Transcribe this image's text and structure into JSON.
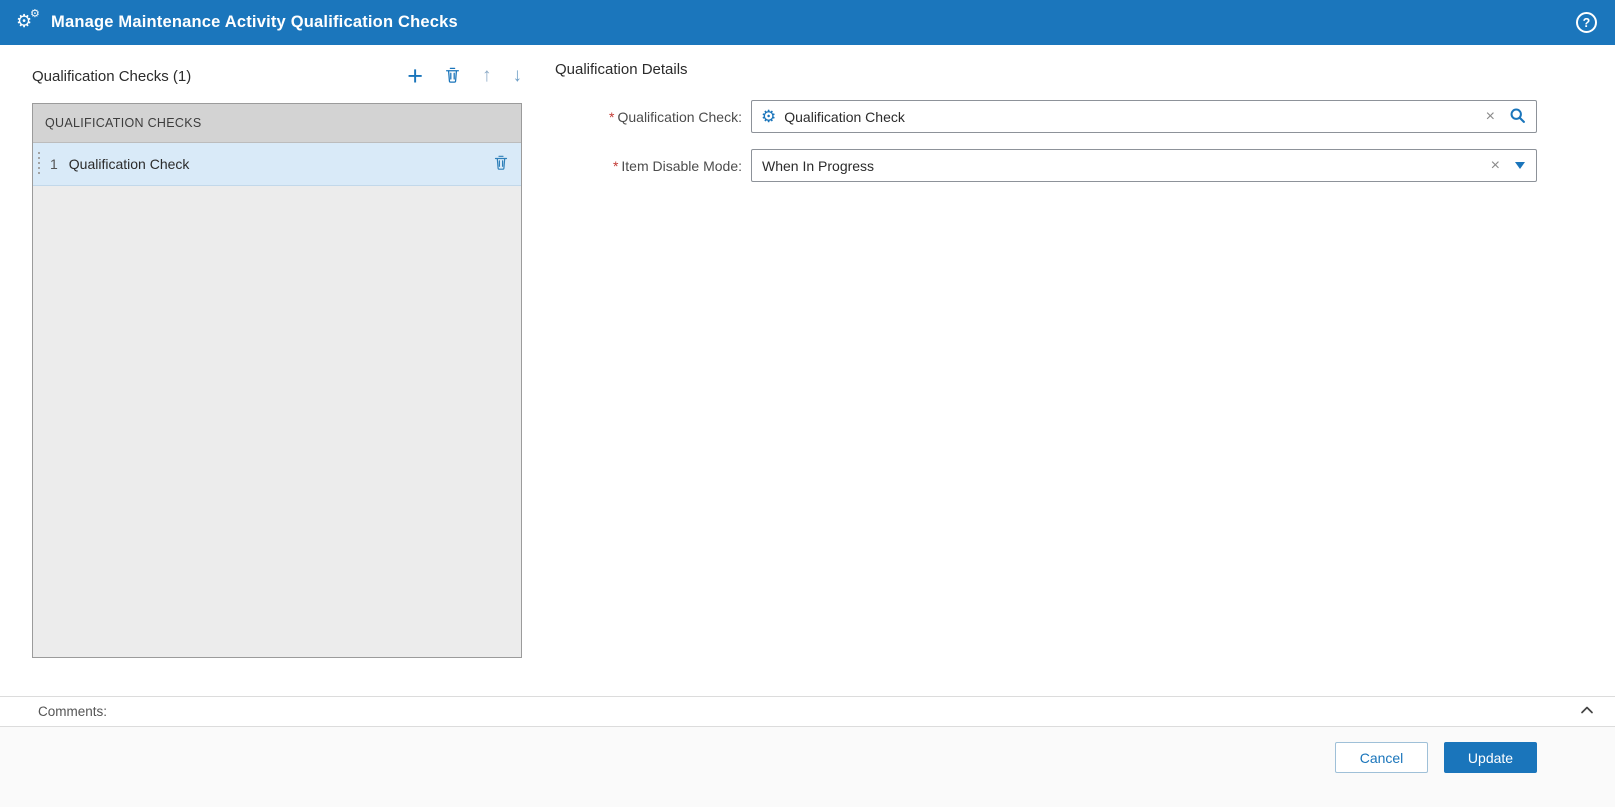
{
  "colors": {
    "accent": "#1b76bc",
    "icon_blue": "#1a75bb",
    "required": "#c23934",
    "selected_row": "#d9eaf8"
  },
  "header": {
    "title": "Manage Maintenance Activity Qualification Checks",
    "help_glyph": "?"
  },
  "left_panel": {
    "title": "Qualification Checks (1)",
    "toolbar": {
      "add_glyph": "+",
      "move_up_glyph": "↑",
      "move_down_glyph": "↓"
    },
    "list": {
      "header": "QUALIFICATION CHECKS",
      "rows": [
        {
          "index": "1",
          "label": "Qualification Check"
        }
      ]
    }
  },
  "details": {
    "title": "Qualification Details",
    "fields": {
      "qualification_check": {
        "required_glyph": "*",
        "label": "Qualification Check:",
        "value": "Qualification Check",
        "clear_glyph": "×"
      },
      "item_disable_mode": {
        "required_glyph": "*",
        "label": "Item Disable Mode:",
        "value": "When In Progress",
        "clear_glyph": "×"
      }
    }
  },
  "comments": {
    "label": "Comments:"
  },
  "footer": {
    "cancel_label": "Cancel",
    "update_label": "Update"
  },
  "icons": {
    "title_gear_big": "⚙",
    "title_gear_small": "⚙",
    "qualification_check_icon": "⚙"
  }
}
